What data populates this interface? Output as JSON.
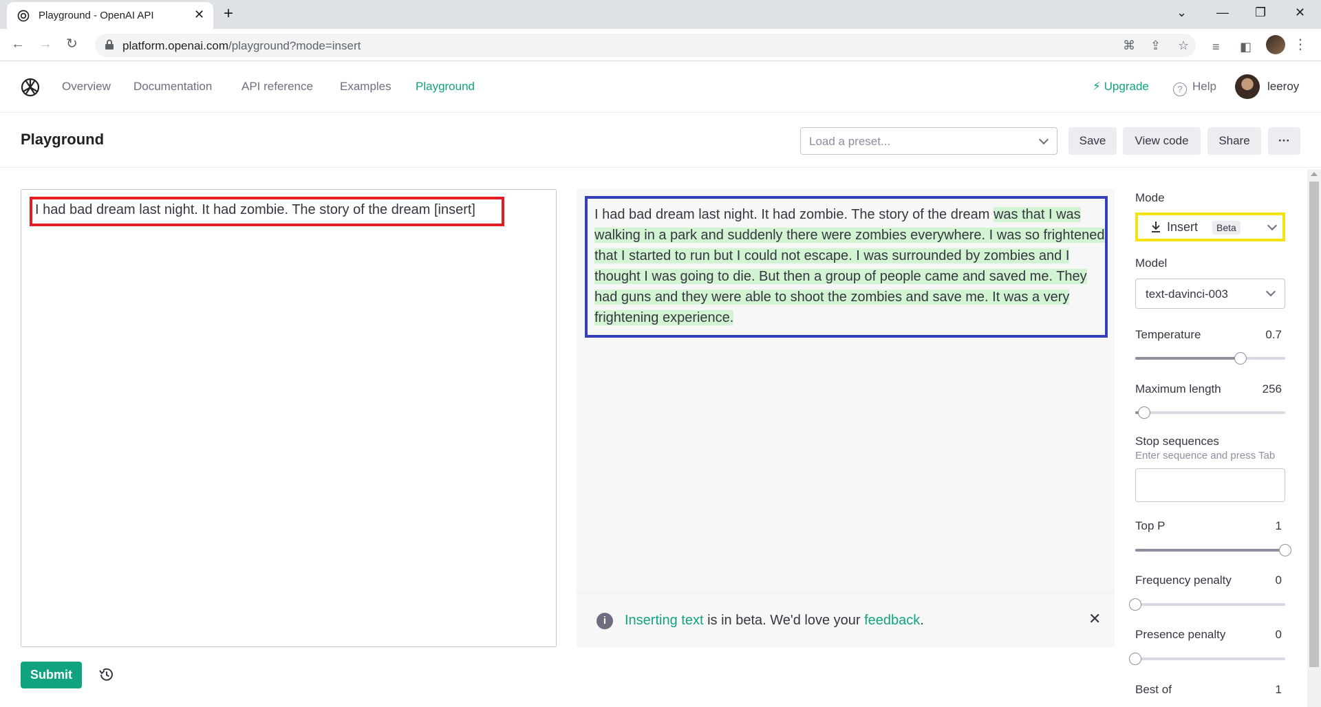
{
  "browser": {
    "tab_title": "Playground - OpenAI API",
    "tab_close": "✕",
    "new_tab": "+",
    "url_host": "platform.openai.com",
    "url_path": "/playground?mode=insert",
    "win_minimize": "—",
    "win_restore": "❐",
    "win_close": "✕",
    "win_dropdown": "⌄"
  },
  "nav": {
    "items": [
      "Overview",
      "Documentation",
      "API reference",
      "Examples",
      "Playground"
    ],
    "active": "Playground",
    "upgrade": "⚡ Upgrade",
    "help": "Help",
    "user": "leeroy"
  },
  "page": {
    "title": "Playground",
    "preset_placeholder": "Load a preset...",
    "save": "Save",
    "view_code": "View code",
    "share": "Share",
    "more": "···"
  },
  "editor": {
    "input_text": "I had bad dream last night. It had zombie. The story of the dream [insert]",
    "output_prefix": "I had bad dream last night. It had zombie. The story of the dream ",
    "output_generated": "was that I was walking in a park and suddenly there were zombies everywhere. I was so frightened that I started to run but I could not escape. I was surrounded by zombies and I thought I was going to die. But then a group of people came and saved me. They had guns and they were able to shoot the zombies and save me. It was a very frightening experience.",
    "banner_link1": "Inserting text",
    "banner_mid": " is in beta. We'd love your ",
    "banner_link2": "feedback",
    "banner_end": ".",
    "submit": "Submit"
  },
  "settings": {
    "mode_label": "Mode",
    "mode_value": "Insert",
    "mode_badge": "Beta",
    "model_label": "Model",
    "model_value": "text-davinci-003",
    "temperature_label": "Temperature",
    "temperature_value": "0.7",
    "temperature_fraction": 0.7,
    "max_length_label": "Maximum length",
    "max_length_value": "256",
    "max_length_fraction": 0.06,
    "stop_label": "Stop sequences",
    "stop_hint": "Enter sequence and press Tab",
    "top_p_label": "Top P",
    "top_p_value": "1",
    "top_p_fraction": 1.0,
    "freq_label": "Frequency penalty",
    "freq_value": "0",
    "freq_fraction": 0.0,
    "presence_label": "Presence penalty",
    "presence_value": "0",
    "presence_fraction": 0.0,
    "best_of_label": "Best of",
    "best_of_value": "1"
  },
  "colors": {
    "accent": "#10a37f",
    "input_highlight": "#e01e24",
    "output_highlight": "#3340b8",
    "mode_highlight": "#f5e211",
    "generated_bg": "#d2f4d3"
  }
}
